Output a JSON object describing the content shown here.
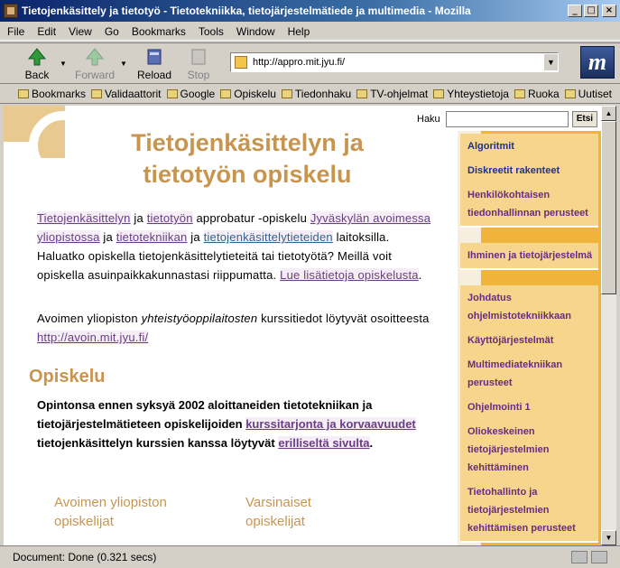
{
  "window": {
    "title": "Tietojenkäsittely ja tietotyö - Tietotekniikka, tietojärjestelmätiede ja multimedia - Mozilla",
    "minimize": "_",
    "maximize": "□",
    "close": "×"
  },
  "menu": [
    "File",
    "Edit",
    "View",
    "Go",
    "Bookmarks",
    "Tools",
    "Window",
    "Help"
  ],
  "nav": {
    "back": "Back",
    "forward": "Forward",
    "reload": "Reload",
    "stop": "Stop",
    "url": "http://appro.mit.jyu.fi/"
  },
  "bookmarks": [
    "Bookmarks",
    "Validaattorit",
    "Google",
    "Opiskelu",
    "Tiedonhaku",
    "TV-ohjelmat",
    "Yhteystietoja",
    "Ruoka",
    "Uutiset"
  ],
  "page": {
    "heading_line1": "Tietojenkäsittelyn ja",
    "heading_line2": "tietotyön opiskelu",
    "p1": {
      "link1": "Tietojenkäsittelyn",
      "t1": " ja ",
      "link2": "tietotyön",
      "t2": " approbatur -opiskelu ",
      "link3": "Jyväskylän avoimessa yliopistossa",
      "t3": " ja ",
      "link4": "tietotekniikan",
      "t4": " ja ",
      "link5": "tietojenkäsittelytieteiden",
      "t5": " laitoksilla. Haluatko opiskella tietojenkäsittelytieteitä tai tietotyötä? Meillä voit opiskella asuinpaikkakunnastasi riippumatta. ",
      "link6": "Lue lisätietoja opiskelusta",
      "t6": "."
    },
    "p2": {
      "t1": "Avoimen yliopiston ",
      "em": "yhteistyöoppilaitosten",
      "t2": " kurssitiedot löytyvät osoitteesta ",
      "link": "http://avoin.mit.jyu.fi/"
    },
    "section_title": "Opiskelu",
    "p3": {
      "t1": "Opintonsa ennen syksyä 2002 aloittaneiden tietotekniikan ja tietojärjestelmätieteen opiskelijoiden ",
      "link1": "kurssitarjonta ja korvaavuudet",
      "t2": " tietojenkäsittelyn kurssien kanssa löytyvät ",
      "link2": "erilliseltä sivulta",
      "t3": "."
    },
    "col1_title": "Avoimen yliopiston opiskelijat",
    "col2_title": "Varsinaiset opiskelijat"
  },
  "search": {
    "label": "Haku",
    "value": "",
    "button": "Etsi"
  },
  "sidebar": [
    "Algoritmit",
    "Diskreetit rakenteet",
    "Henkilökohtaisen tiedonhallinnan perusteet",
    "Ihminen ja tietojärjestelmä",
    "Johdatus ohjelmistotekniikkaan",
    "Käyttöjärjestelmät",
    "Multimediatekniikan perusteet",
    "Ohjelmointi 1",
    "Oliokeskeinen tietojärjestelmien kehittäminen",
    "Tietohallinto ja tietojärjestelmien kehittämisen perusteet"
  ],
  "status": {
    "text": "Document: Done (0.321 secs)"
  },
  "colors": {
    "accent": "#c8954f",
    "link": "#6a3d86",
    "sidebar": "#f0b43a",
    "titlebar": "#0a246a"
  }
}
